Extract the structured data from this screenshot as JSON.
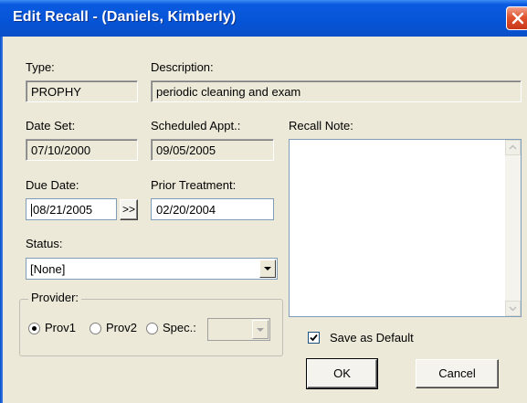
{
  "window": {
    "title": "Edit Recall - (Daniels, Kimberly)"
  },
  "fields": {
    "type_label": "Type:",
    "type_value": "PROPHY",
    "description_label": "Description:",
    "description_value": "periodic cleaning and exam",
    "date_set_label": "Date Set:",
    "date_set_value": "07/10/2000",
    "scheduled_label": "Scheduled Appt.:",
    "scheduled_value": "09/05/2005",
    "due_date_label": "Due Date:",
    "due_date_value": "08/21/2005",
    "advance_button": ">>",
    "prior_treatment_label": "Prior Treatment:",
    "prior_treatment_value": "02/20/2004",
    "status_label": "Status:",
    "status_value": "[None]",
    "recall_note_label": "Recall Note:",
    "recall_note_value": ""
  },
  "provider": {
    "legend": "Provider:",
    "options": [
      "Prov1",
      "Prov2",
      "Spec.:"
    ],
    "selected": "Prov1",
    "spec_value": ""
  },
  "save_default": {
    "label": "Save as Default",
    "checked": true
  },
  "buttons": {
    "ok": "OK",
    "cancel": "Cancel"
  },
  "colors": {
    "titlebar": "#0654d6",
    "dialog": "#ece9d8",
    "close": "#e0542e"
  }
}
